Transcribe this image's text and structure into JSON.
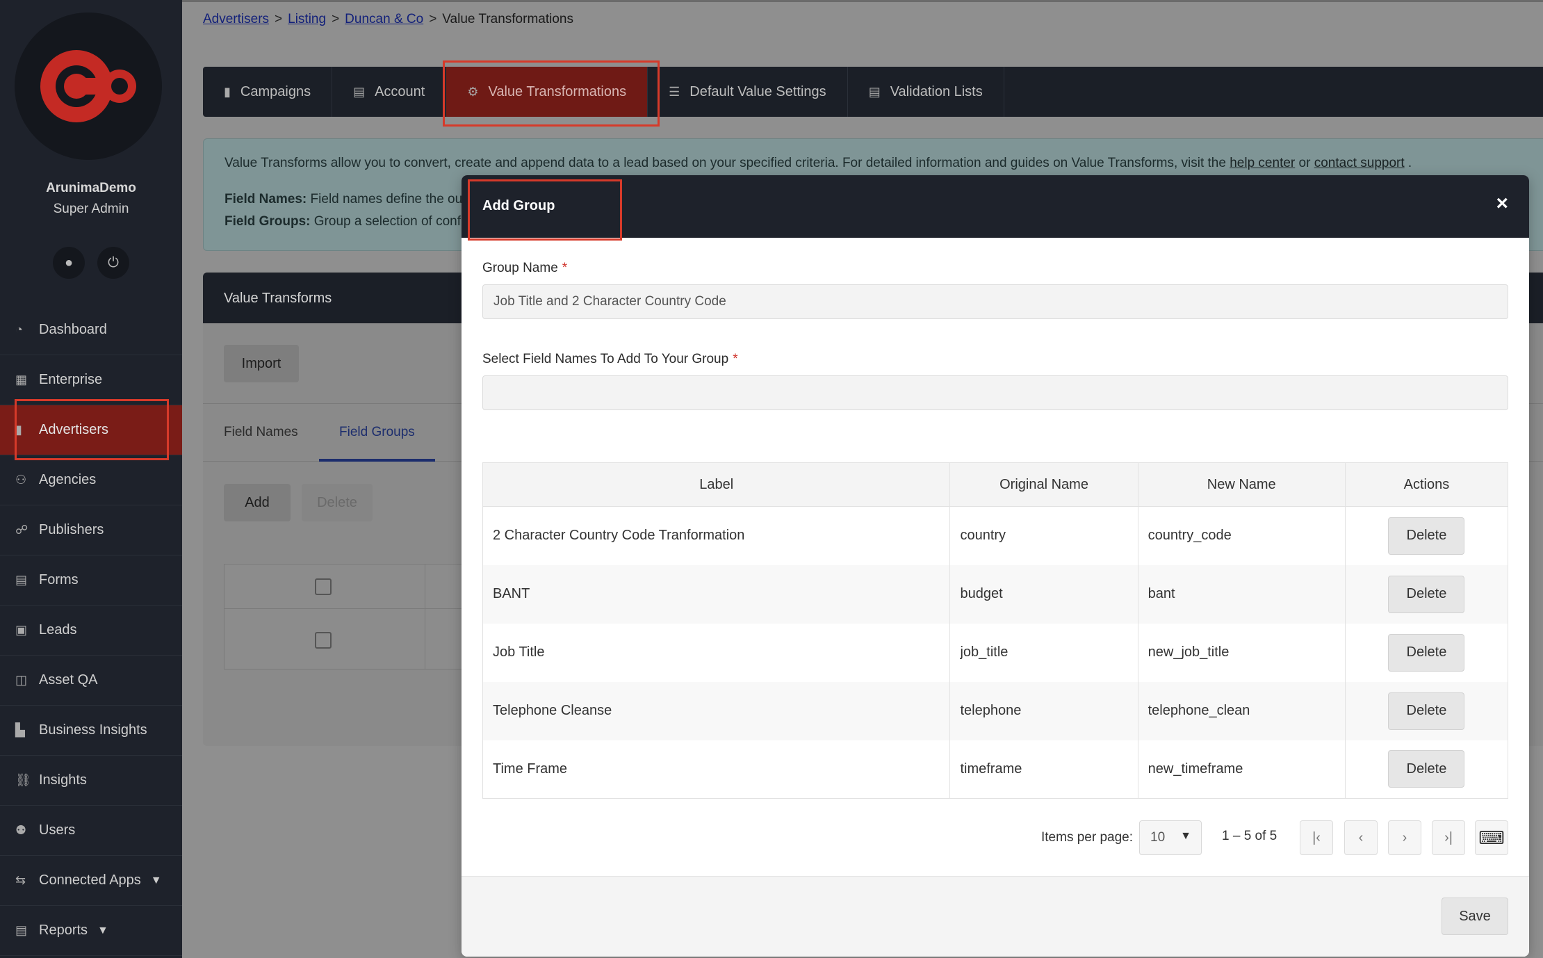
{
  "user": {
    "name": "ArunimaDemo",
    "role": "Super Admin"
  },
  "nav": [
    {
      "label": "Dashboard",
      "icon": "dashboard-icon",
      "glyph": "◔"
    },
    {
      "label": "Enterprise",
      "icon": "building-icon",
      "glyph": "▦"
    },
    {
      "label": "Advertisers",
      "icon": "advertiser-icon",
      "glyph": "▮"
    },
    {
      "label": "Agencies",
      "icon": "agency-icon",
      "glyph": "⚇"
    },
    {
      "label": "Publishers",
      "icon": "publisher-icon",
      "glyph": "☍"
    },
    {
      "label": "Forms",
      "icon": "form-icon",
      "glyph": "▤"
    },
    {
      "label": "Leads",
      "icon": "leads-icon",
      "glyph": "▣"
    },
    {
      "label": "Asset QA",
      "icon": "asset-qa-icon",
      "glyph": "◫"
    },
    {
      "label": "Business Insights",
      "icon": "chart-icon",
      "glyph": "▙"
    },
    {
      "label": "Insights",
      "icon": "insights-icon",
      "glyph": "⛓"
    },
    {
      "label": "Users",
      "icon": "users-icon",
      "glyph": "⚉"
    },
    {
      "label": "Connected Apps",
      "icon": "connected-apps-icon",
      "glyph": "⇆"
    },
    {
      "label": "Reports",
      "icon": "reports-icon",
      "glyph": "▤"
    }
  ],
  "breadcrumb": {
    "b1": "Advertisers",
    "b2": "Listing",
    "b3": "Duncan & Co",
    "current": "Value Transformations",
    "sep": ">"
  },
  "tabs": [
    {
      "label": "Campaigns"
    },
    {
      "label": "Account"
    },
    {
      "label": "Value Transformations"
    },
    {
      "label": "Default Value Settings"
    },
    {
      "label": "Validation Lists"
    }
  ],
  "info": {
    "intro": "Value Transforms allow you to convert, create and append data to a lead based on your specified criteria. For detailed information and guides on Value Transforms, visit the",
    "help_link": "help center",
    "or": "or",
    "support_link": "contact support",
    "end": ".",
    "field_names_label": "Field Names:",
    "field_names_text": "Field names define the ou",
    "field_groups_label": "Field Groups:",
    "field_groups_text": "Group a selection of confi"
  },
  "section": {
    "title": "Value Transforms",
    "import_label": "Import",
    "subtab_names": "Field Names",
    "subtab_groups": "Field Groups",
    "add_label": "Add",
    "delete_label": "Delete"
  },
  "modal": {
    "title": "Add Group",
    "close_glyph": "×",
    "group_name_label": "Group Name",
    "required_mark": "*",
    "group_name_value": "Job Title and 2 Character Country Code",
    "select_label": "Select Field Names To Add To Your Group",
    "select_value": "",
    "columns": {
      "label": "Label",
      "original": "Original Name",
      "new": "New Name",
      "actions": "Actions"
    },
    "rows": [
      {
        "label": "2 Character Country Code Tranformation",
        "original": "country",
        "new": "country_code",
        "action": "Delete"
      },
      {
        "label": "BANT",
        "original": "budget",
        "new": "bant",
        "action": "Delete"
      },
      {
        "label": "Job Title",
        "original": "job_title",
        "new": "new_job_title",
        "action": "Delete"
      },
      {
        "label": "Telephone Cleanse",
        "original": "telephone",
        "new": "telephone_clean",
        "action": "Delete"
      },
      {
        "label": "Time Frame",
        "original": "timeframe",
        "new": "new_timeframe",
        "action": "Delete"
      }
    ],
    "pager": {
      "items_per_page_label": "Items per page:",
      "items_per_page": "10",
      "range": "1 – 5 of 5",
      "first_glyph": "|‹",
      "prev_glyph": "‹",
      "next_glyph": "›",
      "last_glyph": "›|",
      "keyboard_glyph": "⌨"
    },
    "save_label": "Save"
  },
  "colors": {
    "accent": "#d63a2a",
    "sidebar": "#1e222b",
    "active_tab": "#6f1a15"
  }
}
